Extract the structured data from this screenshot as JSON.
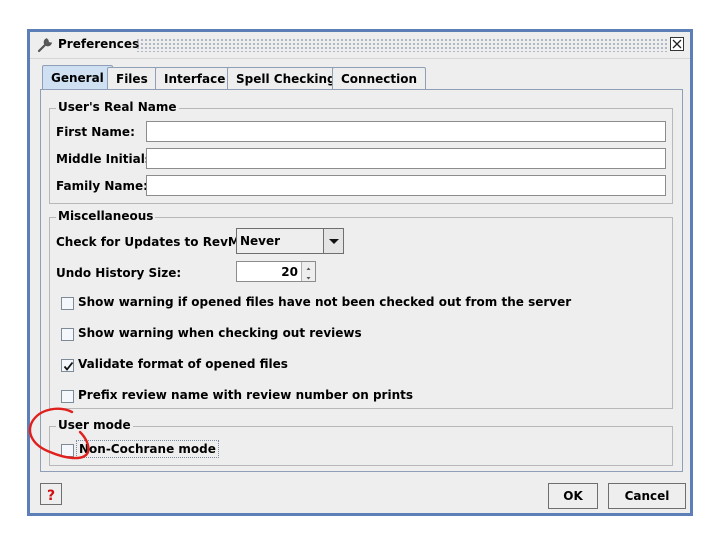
{
  "window": {
    "title": "Preferences",
    "close_icon": "close-icon",
    "title_icon": "wrench-icon"
  },
  "tabs": [
    {
      "label": "General",
      "active": true
    },
    {
      "label": "Files"
    },
    {
      "label": "Interface"
    },
    {
      "label": "Spell Checking"
    },
    {
      "label": "Connection"
    }
  ],
  "real_name": {
    "group_title": "User's Real Name",
    "first_name_label": "First Name:",
    "first_name_value": "",
    "middle_initials_label": "Middle Initials:",
    "middle_initials_value": "",
    "family_name_label": "Family Name:",
    "family_name_value": ""
  },
  "misc": {
    "group_title": "Miscellaneous",
    "check_updates_label": "Check for Updates to RevMan:",
    "check_updates_value": "Never",
    "undo_history_label": "Undo History Size:",
    "undo_history_value": "20",
    "checkboxes": [
      {
        "label": "Show warning if opened files have not been checked out from the server",
        "checked": false
      },
      {
        "label": "Show warning when checking out reviews",
        "checked": false
      },
      {
        "label": "Validate format of opened files",
        "checked": true
      },
      {
        "label": "Prefix review name with review number on prints",
        "checked": false
      }
    ]
  },
  "user_mode": {
    "group_title": "User mode",
    "non_cochrane_label": "Non-Cochrane mode",
    "non_cochrane_checked": false
  },
  "footer": {
    "help_icon": "question-icon",
    "ok_label": "OK",
    "cancel_label": "Cancel"
  },
  "annotation": {
    "color": "#e0201c"
  }
}
